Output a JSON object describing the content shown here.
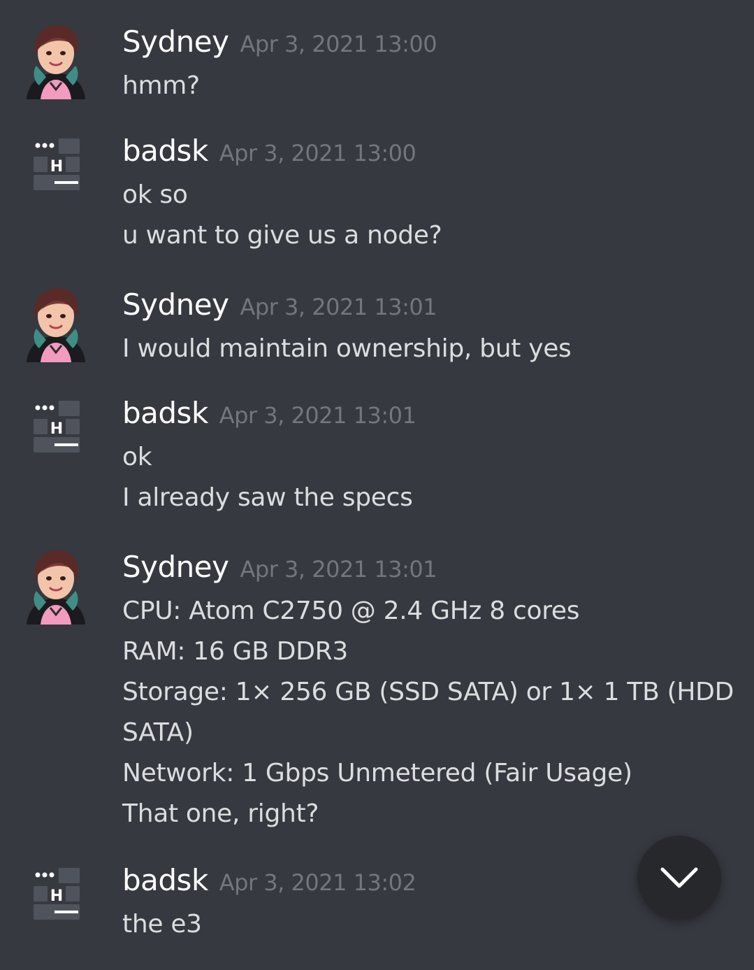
{
  "messages": [
    {
      "author": "Sydney",
      "timestamp": "Apr 3, 2021 13:00",
      "avatar_icon": "user-avatar-icon",
      "lines": [
        "hmm?"
      ]
    },
    {
      "author": "badsk",
      "timestamp": "Apr 3, 2021 13:00",
      "avatar_icon": "server-avatar-icon",
      "avatar_letter": "H",
      "lines": [
        "ok so",
        "u want to give us a node?"
      ]
    },
    {
      "author": "Sydney",
      "timestamp": "Apr 3, 2021 13:01",
      "avatar_icon": "user-avatar-icon",
      "lines": [
        "I would maintain ownership, but yes"
      ]
    },
    {
      "author": "badsk",
      "timestamp": "Apr 3, 2021 13:01",
      "avatar_icon": "server-avatar-icon",
      "avatar_letter": "H",
      "lines": [
        "ok",
        "I already saw the specs"
      ]
    },
    {
      "author": "Sydney",
      "timestamp": "Apr 3, 2021 13:01",
      "avatar_icon": "user-avatar-icon",
      "lines": [
        "CPU: Atom C2750 @ 2.4 GHz 8 cores",
        "RAM: 16 GB DDR3",
        "Storage: 1× 256 GB (SSD SATA) or 1× 1 TB (HDD",
        "SATA)",
        "Network: 1 Gbps Unmetered (Fair Usage)",
        "That one, right?"
      ]
    },
    {
      "author": "badsk",
      "timestamp": "Apr 3, 2021 13:02",
      "avatar_icon": "server-avatar-icon",
      "avatar_letter": "H",
      "lines": [
        "the e3"
      ]
    }
  ],
  "scroll_button": {
    "icon": "chevron-down-icon"
  },
  "colors": {
    "background": "#36393f",
    "username": "#ffffff",
    "timestamp": "#72767d",
    "message_text": "#dcddde",
    "scroll_button": "#26282c"
  }
}
